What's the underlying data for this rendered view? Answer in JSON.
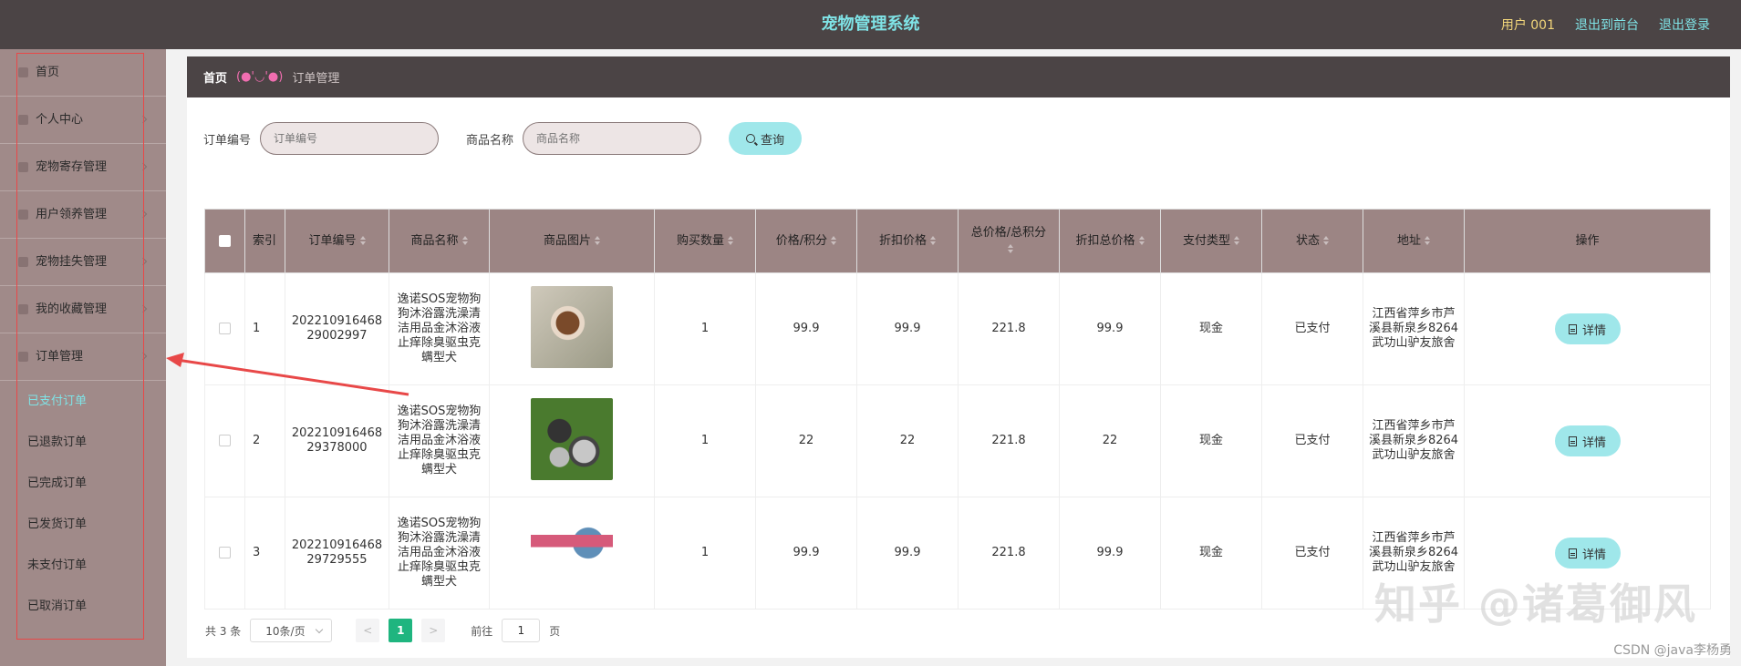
{
  "header": {
    "title": "宠物管理系统",
    "user": "用户 001",
    "to_front": "退出到前台",
    "logout": "退出登录"
  },
  "sidebar": {
    "items": [
      {
        "label": "首页",
        "icon": "home-icon"
      },
      {
        "label": "个人中心",
        "icon": "user-icon"
      },
      {
        "label": "宠物寄存管理",
        "icon": "box-icon"
      },
      {
        "label": "用户领养管理",
        "icon": "paw-icon"
      },
      {
        "label": "宠物挂失管理",
        "icon": "alert-icon"
      },
      {
        "label": "我的收藏管理",
        "icon": "star-icon"
      },
      {
        "label": "订单管理",
        "icon": "order-icon"
      }
    ],
    "sub_items": [
      "已支付订单",
      "已退款订单",
      "已完成订单",
      "已发货订单",
      "未支付订单",
      "已取消订单"
    ],
    "active_sub": "已支付订单"
  },
  "breadcrumb": {
    "home": "首页",
    "face": "(●'◡'●)",
    "current": "订单管理"
  },
  "search": {
    "order_label": "订单编号",
    "order_placeholder": "订单编号",
    "product_label": "商品名称",
    "product_placeholder": "商品名称",
    "button": "查询"
  },
  "table": {
    "headers": [
      "索引",
      "订单编号",
      "商品名称",
      "商品图片",
      "购买数量",
      "价格/积分",
      "折扣价格",
      "总价格/总积分",
      "折扣总价格",
      "支付类型",
      "状态",
      "地址",
      "操作"
    ],
    "rows": [
      {
        "index": "1",
        "order_no": "20221091646829002997",
        "product": "逸诺SOS宠物狗狗沐浴露洗澡清洁用品金沐浴液止痒除臭驱虫克螨型犬",
        "qty": "1",
        "price": "99.9",
        "discount": "99.9",
        "total": "221.8",
        "discount_total": "99.9",
        "pay": "现金",
        "status": "已支付",
        "address": "江西省萍乡市芦溪县新泉乡8264武功山驴友旅舍",
        "action": "详情"
      },
      {
        "index": "2",
        "order_no": "20221091646829378000",
        "product": "逸诺SOS宠物狗狗沐浴露洗澡清洁用品金沐浴液止痒除臭驱虫克螨型犬",
        "qty": "1",
        "price": "22",
        "discount": "22",
        "total": "221.8",
        "discount_total": "22",
        "pay": "现金",
        "status": "已支付",
        "address": "江西省萍乡市芦溪县新泉乡8264武功山驴友旅舍",
        "action": "详情"
      },
      {
        "index": "3",
        "order_no": "20221091646829729555",
        "product": "逸诺SOS宠物狗狗沐浴露洗澡清洁用品金沐浴液止痒除臭驱虫克螨型犬",
        "qty": "1",
        "price": "99.9",
        "discount": "99.9",
        "total": "221.8",
        "discount_total": "99.9",
        "pay": "现金",
        "status": "已支付",
        "address": "江西省萍乡市芦溪县新泉乡8264武功山驴友旅舍",
        "action": "详情"
      }
    ]
  },
  "pager": {
    "total": "共 3 条",
    "page_size": "10条/页",
    "prev": "<",
    "current": "1",
    "next": ">",
    "goto_label": "前往",
    "goto_value": "1",
    "page_suffix": "页"
  },
  "watermark": "知乎 @诸葛御风",
  "csdn": "CSDN @java李杨勇",
  "colors": {
    "header_bg": "#4b4445",
    "accent": "#7fe3e6",
    "sidebar_bg": "#a08a89",
    "table_head": "#9c8584",
    "button": "#9fe7ea",
    "page_active": "#1fb57f"
  }
}
